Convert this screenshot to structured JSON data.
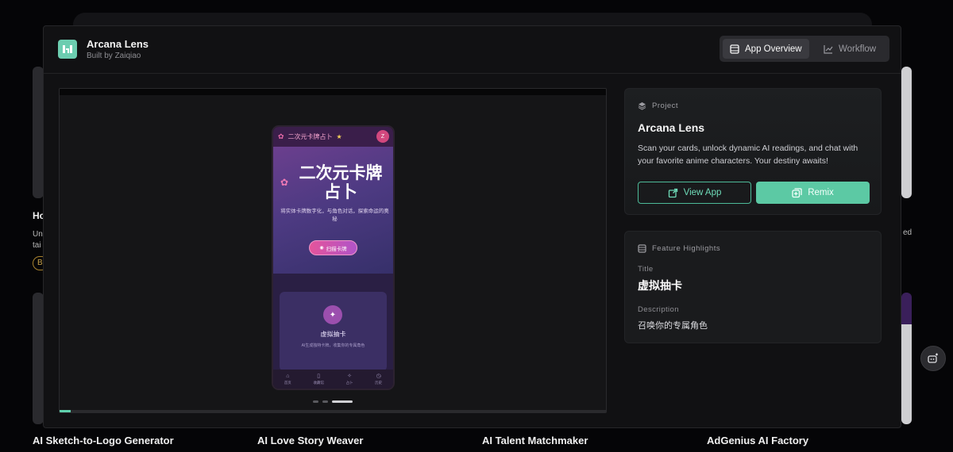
{
  "background": {
    "gallery_titles": [
      "AI Sketch-to-Logo Generator",
      "AI Love Story Weaver",
      "AI Talent Matchmaker",
      "AdGenius AI Factory"
    ],
    "fragments": {
      "left_title": "Ho",
      "left_line1": "Un",
      "left_line2": "tai",
      "left_badge": "B",
      "right_frag": "ed"
    }
  },
  "modal": {
    "app_title": "Arcana Lens",
    "app_subtitle": "Built by Zaiqiao",
    "tabs": [
      {
        "label": "App Overview",
        "icon": "film-icon",
        "active": true
      },
      {
        "label": "Workflow",
        "icon": "chart-line-icon",
        "active": false
      }
    ]
  },
  "preview": {
    "progress_fraction": 0.02,
    "slide_count": 3,
    "active_slide": 3,
    "phone": {
      "header_title": "二次元卡牌占卜",
      "avatar_letter": "Z",
      "hero_title": "二次元卡牌占卜",
      "hero_subtitle": "将实体卡牌数字化，与角色对话，探索命运的奥秘",
      "scan_button": "扫描卡牌",
      "card_title": "虚拟抽卡",
      "card_subtitle": "AI生成独特卡牌，收集你的专属角色",
      "nav": [
        "首页",
        "收藏馆",
        "占卜",
        "历史"
      ]
    }
  },
  "project": {
    "section_label": "Project",
    "name": "Arcana Lens",
    "description": "Scan your cards, unlock dynamic AI readings, and chat with your favorite anime characters. Your destiny awaits!",
    "view_button": "View App",
    "remix_button": "Remix"
  },
  "features": {
    "section_label": "Feature Highlights",
    "title_key": "Title",
    "title_value": "虚拟抽卡",
    "description_key": "Description",
    "description_value": "召唤你的专属角色"
  },
  "colors": {
    "accent": "#5cc9a4",
    "accent_text": "#6fdcb9",
    "modal_bg": "#111113",
    "card_bg": "#1a1b1d"
  }
}
